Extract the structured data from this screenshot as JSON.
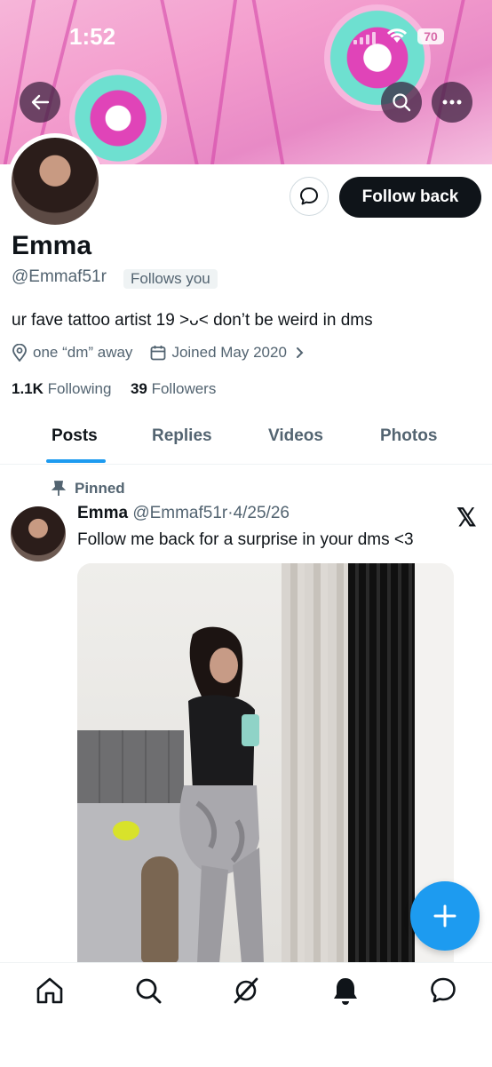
{
  "status_bar": {
    "time": "1:52",
    "battery": "70"
  },
  "profile": {
    "name": "Emma",
    "handle": "@Emmaf51r",
    "follows_you": "Follows you",
    "follow_label": "Follow back",
    "bio": "ur fave tattoo artist 19 ˃ᴗ˂ don’t be weird in dms",
    "location": "one “dm” away",
    "joined": "Joined May 2020",
    "following_count": "1.1K",
    "following_label": "Following",
    "followers_count": "39",
    "followers_label": "Followers"
  },
  "tabs": [
    {
      "label": "Posts",
      "active": true
    },
    {
      "label": "Replies",
      "active": false
    },
    {
      "label": "Videos",
      "active": false
    },
    {
      "label": "Photos",
      "active": false
    }
  ],
  "post": {
    "pinned_label": "Pinned",
    "author": "Emma",
    "handle": "@Emmaf51r",
    "separator": "·",
    "date": "4/25/26",
    "text": "Follow me back for a surprise in your dms <3",
    "source_icon": "x-logo"
  },
  "bottom_nav": [
    "home-icon",
    "search-icon",
    "grok-icon",
    "notifications-icon",
    "messages-icon"
  ],
  "colors": {
    "accent": "#1d9bf0",
    "text": "#0f1419",
    "secondary": "#536471"
  }
}
